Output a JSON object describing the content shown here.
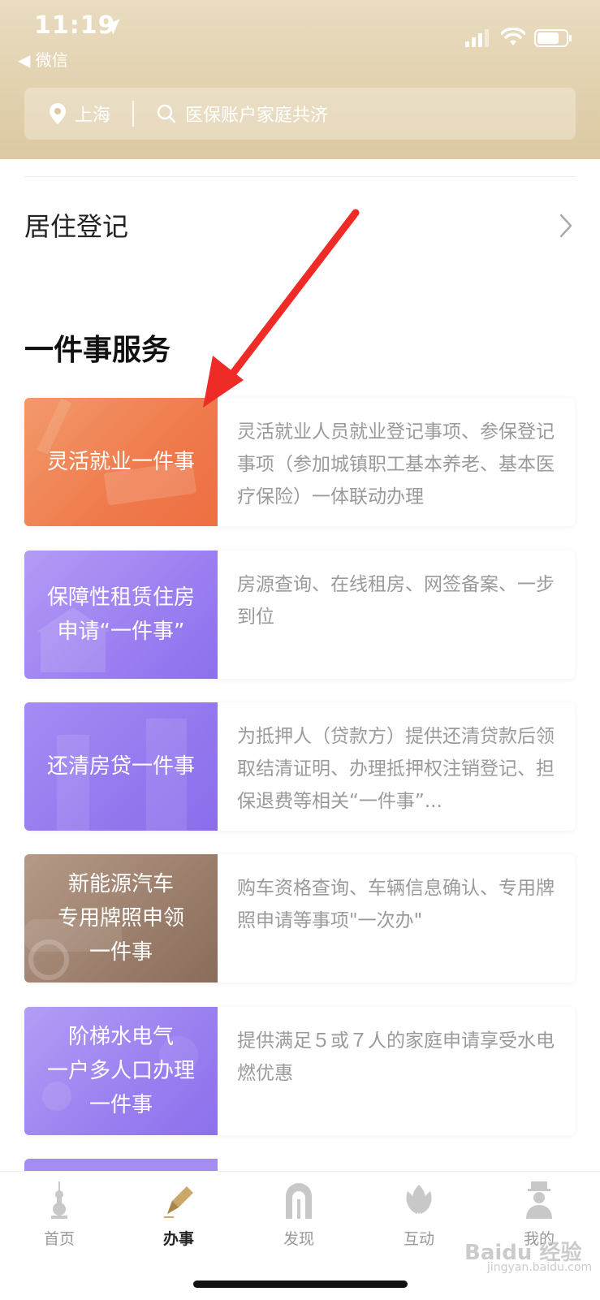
{
  "status_bar": {
    "time": "11:19",
    "back_app": "◀ 微信"
  },
  "search": {
    "city": "上海",
    "placeholder": "医保账户家庭共济"
  },
  "residence": {
    "title": "居住登记"
  },
  "section": {
    "title": "一件事服务"
  },
  "services": [
    {
      "banner": "灵活就业一件事",
      "desc": "灵活就业人员就业登记事项、参保登记事项（参加城镇职工基本养老、基本医疗保险）一体联动办理"
    },
    {
      "banner": "保障性租赁住房\n申请“一件事”",
      "desc": "房源查询、在线租房、网签备案、一步到位"
    },
    {
      "banner": "还清房贷一件事",
      "desc": "为抵押人（贷款方）提供还清贷款后领取结清证明、办理抵押权注销登记、担保退费等相关“一件事”..."
    },
    {
      "banner": "新能源汽车\n专用牌照申领\n一件事",
      "desc": "购车资格查询、车辆信息确认、专用牌照申请等事项\"一次办\""
    },
    {
      "banner": "阶梯水电气\n一户多人口办理\n一件事",
      "desc": "提供满足５或７人的家庭申请享受水电燃优惠"
    }
  ],
  "tabs": [
    {
      "label": "首页",
      "icon": "tower-icon",
      "active": false
    },
    {
      "label": "办事",
      "icon": "pen-icon",
      "active": true
    },
    {
      "label": "发现",
      "icon": "arch-icon",
      "active": false
    },
    {
      "label": "互动",
      "icon": "magnolia-icon",
      "active": false
    },
    {
      "label": "我的",
      "icon": "person-icon",
      "active": false
    }
  ],
  "watermark": {
    "main": "Baidu 经验",
    "sub": "jingyan.baidu.com"
  },
  "colors": {
    "header_gold": "#dcc9a2",
    "annotation_red": "#ee2b26",
    "active_tab_icon": "#c9a86a",
    "inactive_tab_icon": "#c8c8c8"
  }
}
